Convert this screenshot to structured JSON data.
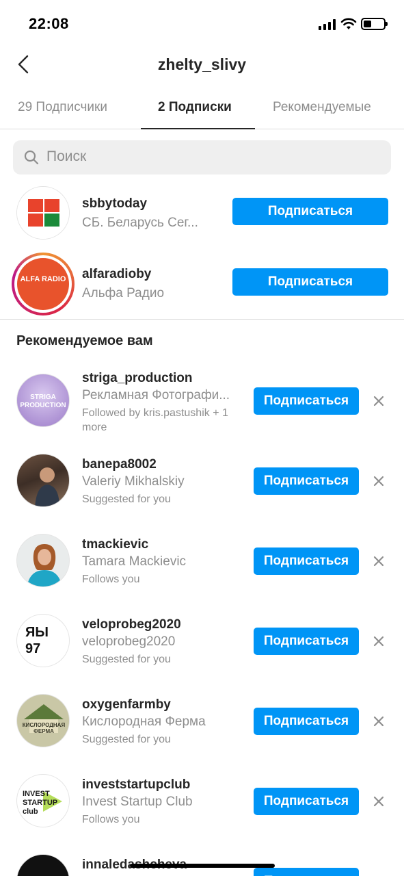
{
  "status_bar": {
    "time": "22:08"
  },
  "header": {
    "title": "zhelty_slivy"
  },
  "tabs": [
    {
      "label": "29 Подписчики",
      "active": false
    },
    {
      "label": "2 Подписки",
      "active": true
    },
    {
      "label": "Рекомендуемые",
      "active": false
    }
  ],
  "search": {
    "placeholder": "Поиск"
  },
  "following": [
    {
      "username": "sbbytoday",
      "fullname": "СБ. Беларусь Сег...",
      "button": "Подписаться"
    },
    {
      "username": "alfaradioby",
      "fullname": "Альфа Радио",
      "button": "Подписаться",
      "avatar_text": "ALFA RADIO"
    }
  ],
  "recommended": {
    "title": "Рекомендуемое вам",
    "items": [
      {
        "username": "striga_production",
        "fullname": "Рекламная Фотографи...",
        "subtext": "Followed by kris.pastushik + 1 more",
        "button": "Подписаться",
        "avatar_text": "STRIGA PRODUCTION"
      },
      {
        "username": "banepa8002",
        "fullname": "Valeriy Mikhalskiy",
        "subtext": "Suggested for you",
        "button": "Подписаться"
      },
      {
        "username": "tmackievic",
        "fullname": "Tamara Mackievic",
        "subtext": "Follows you",
        "button": "Подписаться"
      },
      {
        "username": "veloprobeg2020",
        "fullname": "veloprobeg2020",
        "subtext": "Suggested for you",
        "button": "Подписаться",
        "avatar_text": "ЯЫ 97"
      },
      {
        "username": "oxygenfarmby",
        "fullname": "Кислородная Ферма",
        "subtext": "Suggested for you",
        "button": "Подписаться",
        "avatar_text": "КИСЛОРОДНАЯ ФЕРМА"
      },
      {
        "username": "investstartupclub",
        "fullname": "Invest Startup Club",
        "subtext": "Follows you",
        "button": "Подписаться",
        "avatar_text": "INVEST STARTUP club"
      },
      {
        "username": "innaledashcheva",
        "fullname": "",
        "subtext": "",
        "button": "Подписаться"
      }
    ]
  },
  "colors": {
    "accent": "#0095f6",
    "text": "#262626",
    "muted": "#8e8e8e"
  }
}
